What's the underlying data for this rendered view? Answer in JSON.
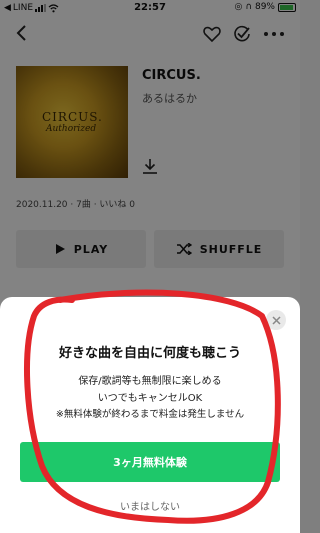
{
  "status_bar": {
    "carrier": "LINE",
    "time": "22:57",
    "battery": "89%"
  },
  "icons": {
    "back": "chevron-left-icon",
    "favorite": "heart-icon",
    "check": "check-circle-icon",
    "more": "more-horizontal-icon",
    "download": "download-icon",
    "play": "play-icon",
    "shuffle": "shuffle-icon",
    "close": "close-icon"
  },
  "album": {
    "cover_title": "CIRCUS.",
    "cover_subtitle": "Authorized",
    "title": "CIRCUS.",
    "artist": "あるはるか",
    "meta": "2020.11.20 · 7曲 · いいね 0"
  },
  "buttons": {
    "play": "PLAY",
    "shuffle": "SHUFFLE"
  },
  "sheet": {
    "headline": "好きな曲を自由に何度も聴こう",
    "line1": "保存/歌詞等も無制限に楽しめる",
    "line2": "いつでもキャンセルOK",
    "line3": "※無料体験が終わるまで料金は発生しません",
    "cta": "3ヶ月無料体験",
    "dismiss": "いまはしない"
  },
  "colors": {
    "accent_green": "#1ec86a",
    "annotation_red": "#e3262a",
    "battery_green": "#3ac24a"
  }
}
